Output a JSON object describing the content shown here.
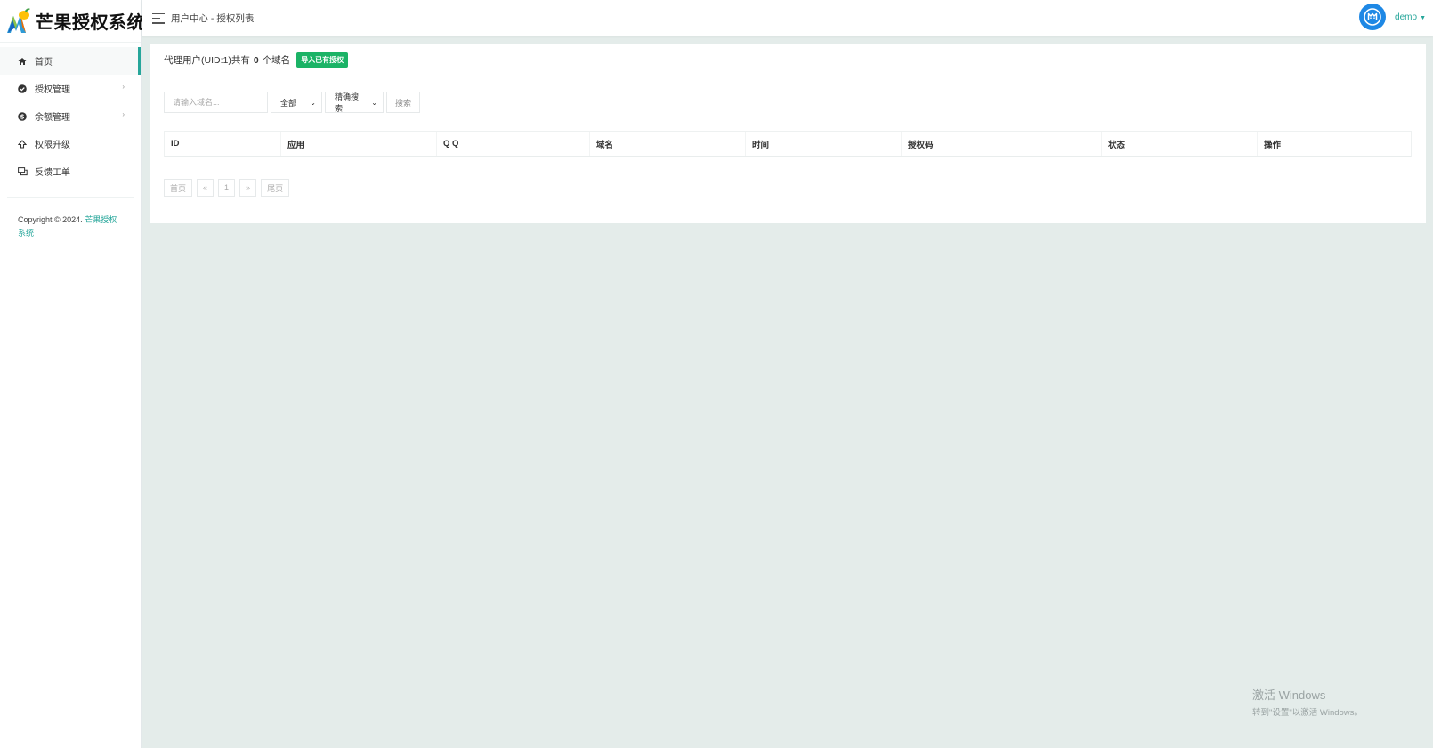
{
  "brand": {
    "name": "芒果授权系统"
  },
  "sidebar": {
    "items": [
      {
        "label": "首页",
        "icon": "home-icon"
      },
      {
        "label": "授权管理",
        "icon": "check-circle-icon",
        "has_children": true
      },
      {
        "label": "余额管理",
        "icon": "currency-icon",
        "has_children": true
      },
      {
        "label": "权限升级",
        "icon": "arrow-up-icon"
      },
      {
        "label": "反馈工单",
        "icon": "comments-icon"
      }
    ],
    "copyright_prefix": "Copyright © 2024.",
    "copyright_link": "芒果授权系统"
  },
  "header": {
    "breadcrumb": "用户中心 - 授权列表",
    "username": "demo"
  },
  "panel": {
    "summary_prefix": "代理用户(UID:1)共有",
    "summary_count": "0",
    "summary_suffix": "个域名",
    "import_button": "导入已有授权"
  },
  "search": {
    "placeholder": "请输入域名...",
    "filter_selected": "全部",
    "mode_selected": "精确搜索",
    "button": "搜索"
  },
  "table": {
    "columns": [
      "ID",
      "应用",
      "Q Q",
      "域名",
      "时间",
      "授权码",
      "状态",
      "操作"
    ],
    "rows": []
  },
  "pagination": {
    "first": "首页",
    "prev": "«",
    "current": "1",
    "next": "»",
    "last": "尾页"
  },
  "watermark": {
    "line1": "激活 Windows",
    "line2": "转到\"设置\"以激活 Windows。"
  },
  "colors": {
    "accent": "#26a69a",
    "import_button": "#1bb366",
    "avatar": "#1e88e5",
    "page_background": "#e4ecea"
  }
}
